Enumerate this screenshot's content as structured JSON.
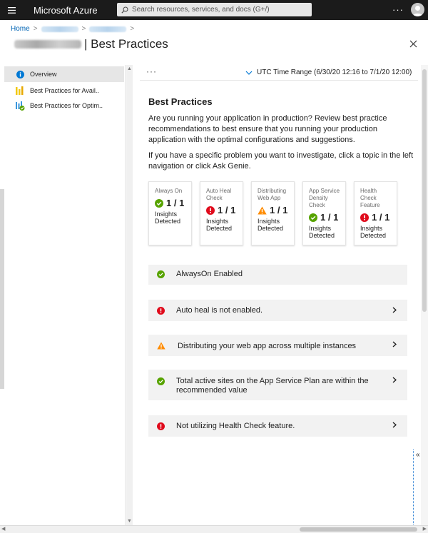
{
  "topbar": {
    "brand": "Microsoft Azure",
    "search_placeholder": "Search resources, services, and docs (G+/)",
    "more": "···"
  },
  "breadcrumb": {
    "home": "Home"
  },
  "title": {
    "text": "| Best Practices"
  },
  "leftnav": {
    "items": [
      {
        "label": "Overview",
        "icon": "info-icon"
      },
      {
        "label": "Best Practices for Avail..",
        "icon": "bar-chart-icon"
      },
      {
        "label": "Best Practices for Optim..",
        "icon": "bar-chart-check-icon"
      }
    ]
  },
  "toolbar": {
    "more": "···",
    "time_range": "UTC Time Range (6/30/20 12:16 to 7/1/20 12:00)"
  },
  "content": {
    "heading": "Best Practices",
    "para1": "Are you running your application in production? Review best practice recommendations to best ensure that you running your production application with the optimal configurations and suggestions.",
    "para2": "If you have a specific problem you want to investigate, click a topic in the left navigation or click Ask Genie."
  },
  "cards": [
    {
      "title": "Always On",
      "metric": "1 / 1",
      "status": "success",
      "sub": "Insights Detected"
    },
    {
      "title": "Auto Heal Check",
      "metric": "1 / 1",
      "status": "error",
      "sub": "Insights Detected"
    },
    {
      "title": "Distributing Web App",
      "metric": "1 / 1",
      "status": "warning",
      "sub": "Insights Detected"
    },
    {
      "title": "App Service Density Check",
      "metric": "1 / 1",
      "status": "success",
      "sub": "Insights Detected"
    },
    {
      "title": "Health Check Feature",
      "metric": "1 / 1",
      "status": "error",
      "sub": "Insights Detected"
    }
  ],
  "insights": [
    {
      "text": "AlwaysOn Enabled",
      "status": "success",
      "expandable": false
    },
    {
      "text": "Auto heal is not enabled.",
      "status": "error",
      "expandable": true
    },
    {
      "text": "Distributing your web app across multiple instances",
      "status": "warning",
      "expandable": true
    },
    {
      "text": "Total active sites on the App Service Plan are within the recommended value",
      "status": "success",
      "expandable": true
    },
    {
      "text": "Not utilizing Health Check feature.",
      "status": "error",
      "expandable": true
    }
  ],
  "panel": {
    "collapse": "«"
  },
  "colors": {
    "success": "#57a300",
    "error": "#e00b1c",
    "warning": "#ff8c00",
    "link": "#0064b4",
    "info": "#0078d4"
  }
}
